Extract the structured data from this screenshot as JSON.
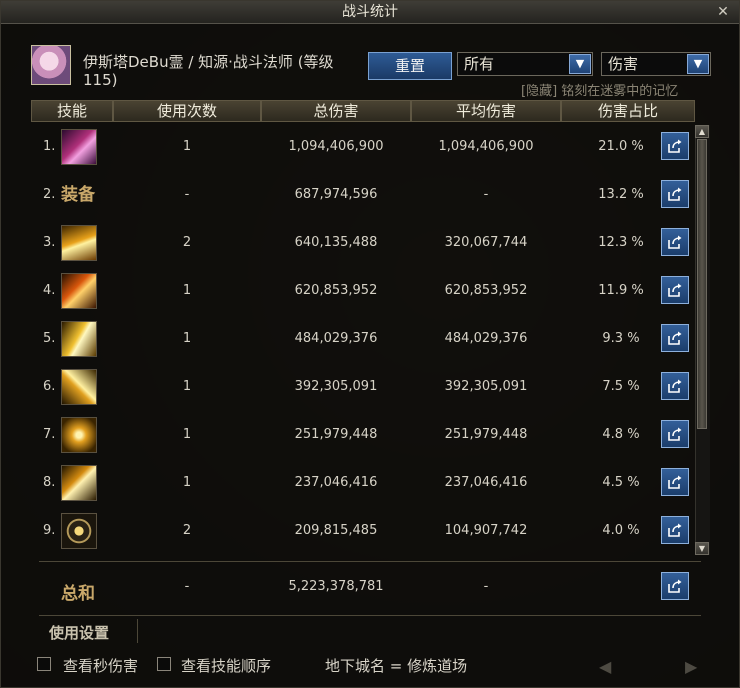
{
  "window": {
    "title": "战斗统计",
    "close_icon": "✕"
  },
  "player": {
    "name": "伊斯塔DeBu霊 / 知源·战斗法师 (等级115)"
  },
  "controls": {
    "reset_label": "重置",
    "filter_select": "所有",
    "metric_select": "伤害",
    "hidden_note": "[隐藏] 铭刻在迷雾中的记忆"
  },
  "table": {
    "headers": [
      "技能",
      "使用次数",
      "总伤害",
      "平均伤害",
      "伤害占比"
    ],
    "rows": [
      {
        "index": "1.",
        "icon": "skill-icon-1",
        "uses": "1",
        "total": "1,094,406,900",
        "avg": "1,094,406,900",
        "share": "21.0 %"
      },
      {
        "index": "2.",
        "label": "装备",
        "uses": "-",
        "total": "687,974,596",
        "avg": "-",
        "share": "13.2 %"
      },
      {
        "index": "3.",
        "icon": "skill-icon-3",
        "uses": "2",
        "total": "640,135,488",
        "avg": "320,067,744",
        "share": "12.3 %"
      },
      {
        "index": "4.",
        "icon": "skill-icon-4",
        "uses": "1",
        "total": "620,853,952",
        "avg": "620,853,952",
        "share": "11.9 %"
      },
      {
        "index": "5.",
        "icon": "skill-icon-5",
        "uses": "1",
        "total": "484,029,376",
        "avg": "484,029,376",
        "share": "9.3 %"
      },
      {
        "index": "6.",
        "icon": "skill-icon-6",
        "uses": "1",
        "total": "392,305,091",
        "avg": "392,305,091",
        "share": "7.5 %"
      },
      {
        "index": "7.",
        "icon": "skill-icon-7",
        "uses": "1",
        "total": "251,979,448",
        "avg": "251,979,448",
        "share": "4.8 %"
      },
      {
        "index": "8.",
        "icon": "skill-icon-8",
        "uses": "1",
        "total": "237,046,416",
        "avg": "237,046,416",
        "share": "4.5 %"
      },
      {
        "index": "9.",
        "icon": "skill-icon-9",
        "uses": "2",
        "total": "209,815,485",
        "avg": "104,907,742",
        "share": "4.0 %"
      }
    ],
    "total": {
      "label": "总和",
      "uses": "-",
      "total": "5,223,378,781",
      "avg": "-"
    }
  },
  "settings": {
    "label": "使用设置"
  },
  "footer": {
    "checkbox_dps": "查看秒伤害",
    "checkbox_order": "查看技能顺序",
    "dungeon": "地下城名 = 修炼道场"
  },
  "colors": {
    "accent_blue": "#2e5b95",
    "gold_text": "#c9a86a",
    "header_bg": "#4a4332"
  }
}
